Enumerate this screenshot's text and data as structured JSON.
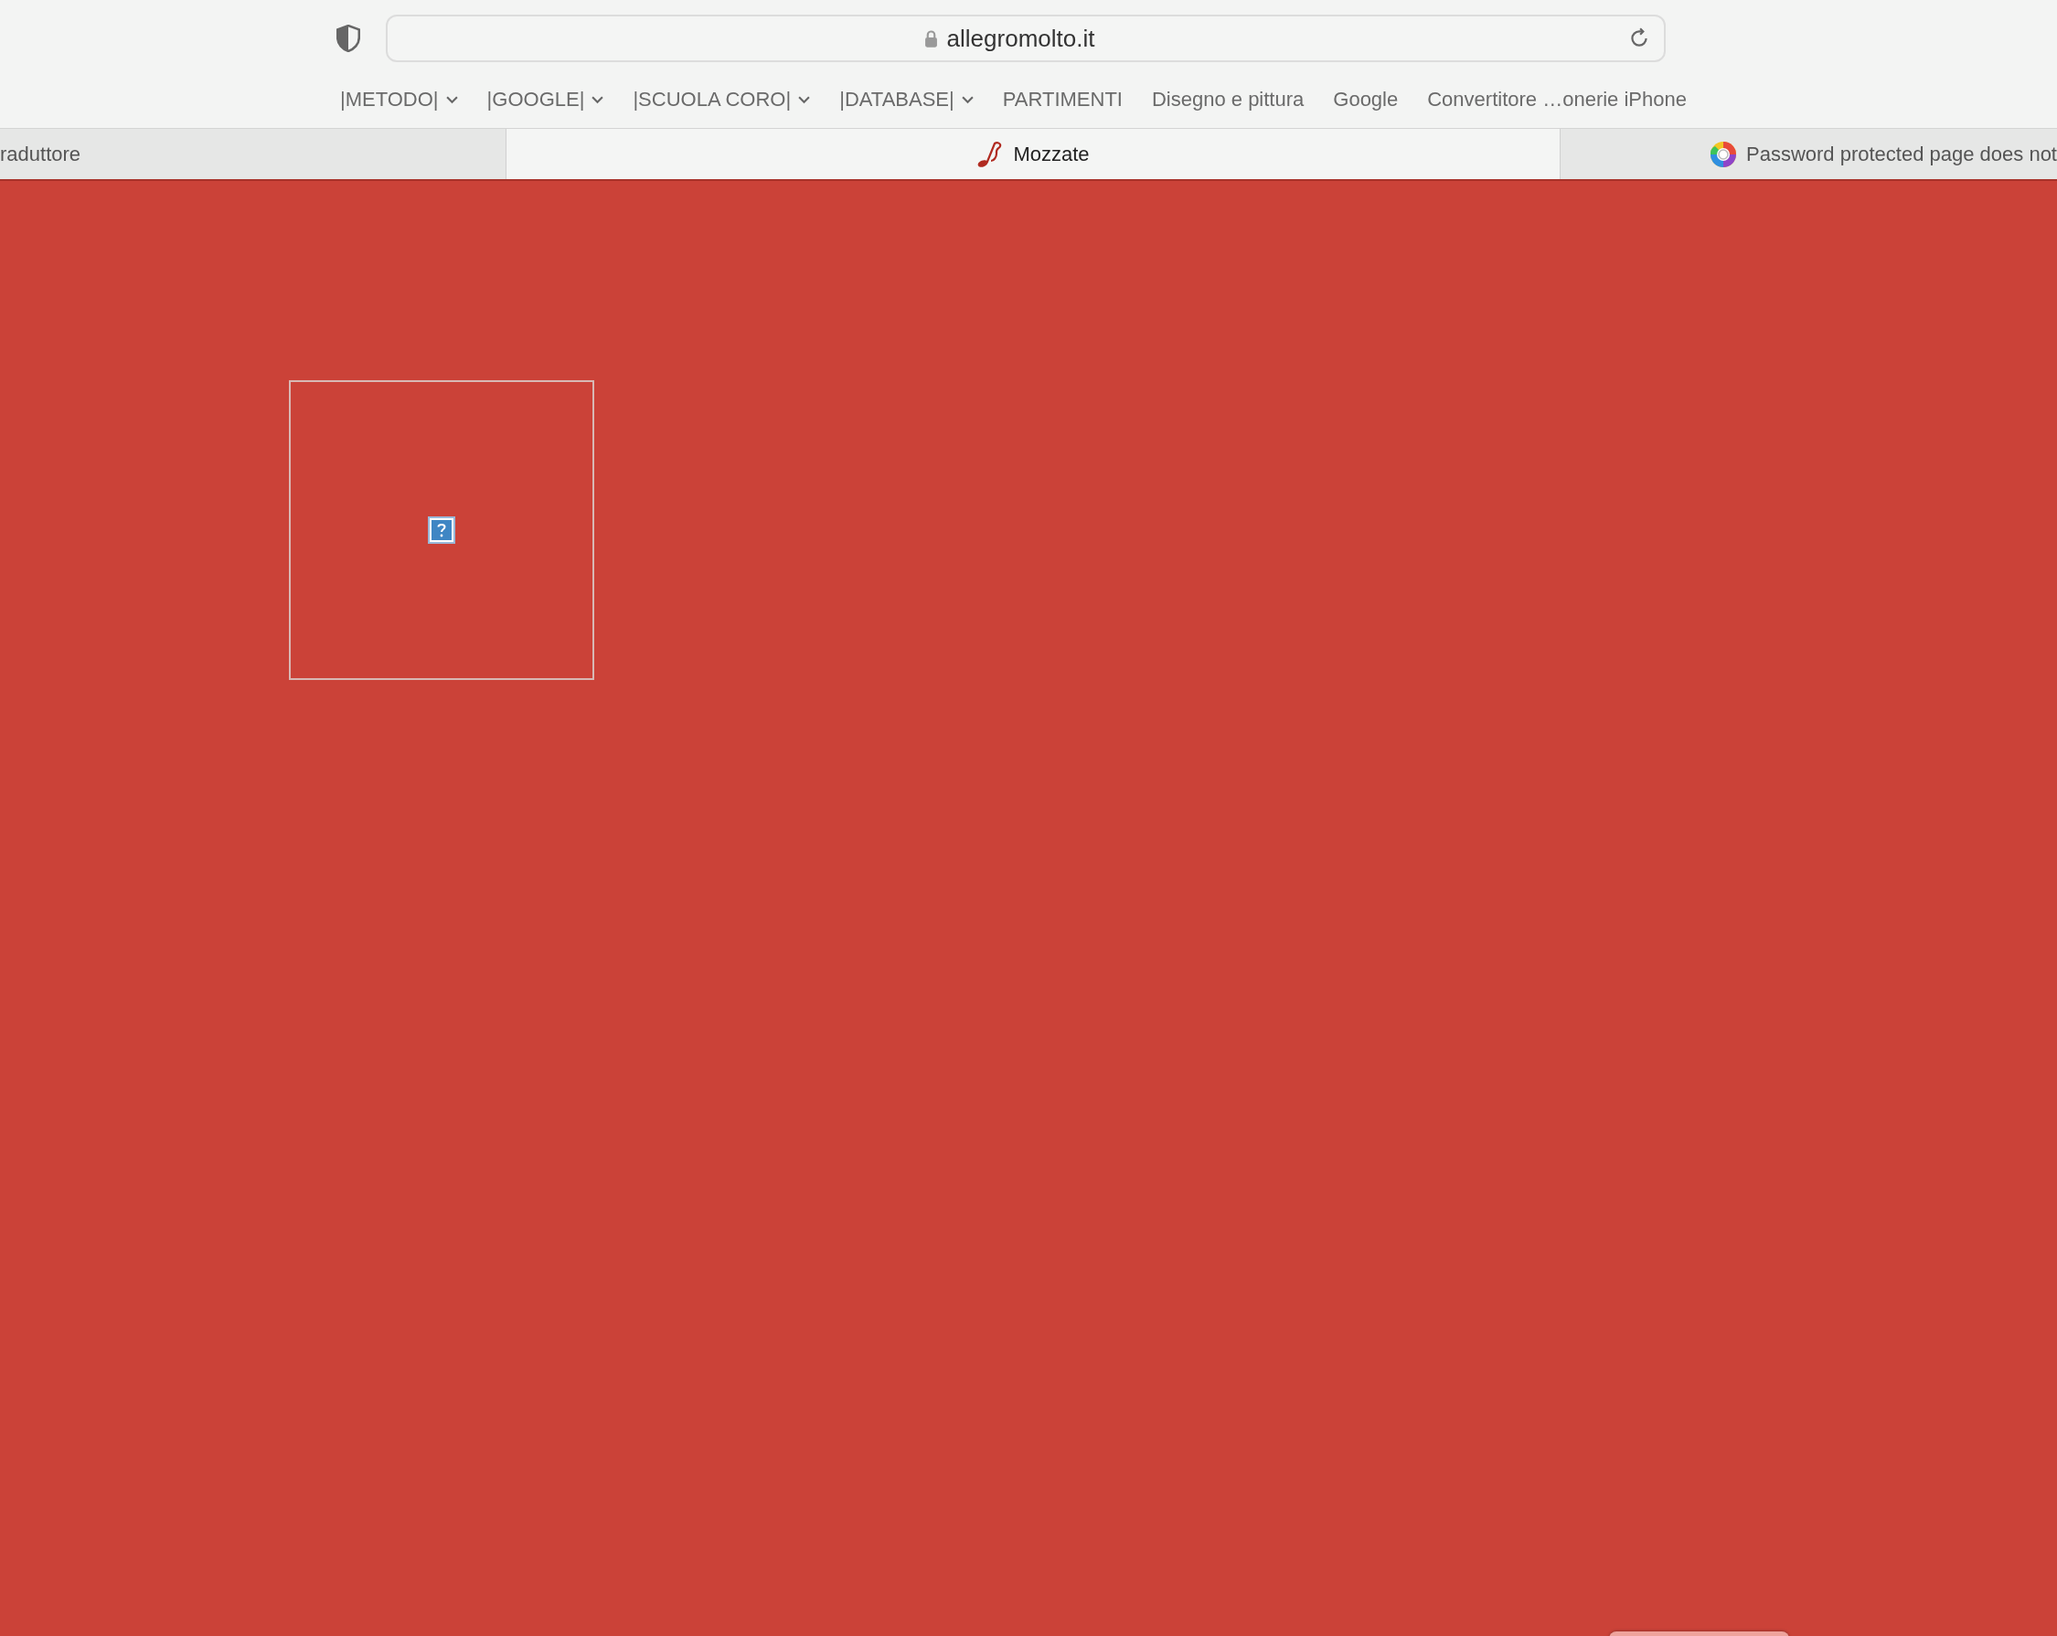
{
  "address_bar": {
    "url": "allegromolto.it"
  },
  "bookmarks": [
    {
      "label": "|METODO|",
      "dropdown": true
    },
    {
      "label": "|GOOGLE|",
      "dropdown": true
    },
    {
      "label": "|SCUOLA CORO|",
      "dropdown": true
    },
    {
      "label": "|DATABASE|",
      "dropdown": true
    },
    {
      "label": "PARTIMENTI",
      "dropdown": false
    },
    {
      "label": "Disegno e pittura",
      "dropdown": false
    },
    {
      "label": "Google",
      "dropdown": false
    },
    {
      "label": "Convertitore …onerie iPhone",
      "dropdown": false
    }
  ],
  "tabs": [
    {
      "title": "raduttore",
      "selected": false
    },
    {
      "title": "Mozzate",
      "selected": true
    },
    {
      "title": "Password protected page does not",
      "selected": false
    }
  ],
  "page": {
    "image": {
      "kind": "missing-image"
    }
  }
}
